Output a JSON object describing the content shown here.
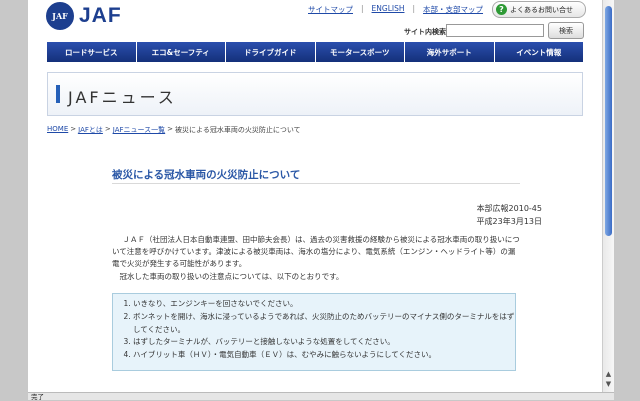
{
  "header": {
    "logo_mark": "JAF",
    "logo_text": "JAF",
    "links": [
      "サイトマップ",
      "ENGLISH",
      "本部・支部マップ"
    ],
    "faq_label": "よくあるお問い合せ",
    "search_label": "サイト内検索",
    "search_value": "",
    "search_button": "検索"
  },
  "nav": [
    "ロードサービス",
    "エコ&セーフティ",
    "ドライブガイド",
    "モータースポーツ",
    "海外サポート",
    "イベント情報"
  ],
  "section_title": "JAFニュース",
  "breadcrumb": {
    "home": "HOME",
    "about": "JAFとは",
    "news_list": "JAFニュース一覧",
    "current": "被災による冠水車両の火災防止について"
  },
  "article": {
    "title": "被災による冠水車両の火災防止について",
    "doc_number": "本部広報2010-45",
    "date": "平成23年3月13日",
    "para1": "ＪＡＦ（社団法人日本自動車連盟、田中節夫会長）は、過去の災害救援の経験から被災による冠水車両の取り扱いについて注意を呼びかけています。津波による被災車両は、海水の塩分により、電気系統（エンジン・ヘッドライト等）の漏電で火災が発生する可能性があります。",
    "para2": "冠水した車両の取り扱いの注意点については、以下のとおりです。",
    "notices": [
      "いきなり、エンジンキーを回さないでください。",
      "ボンネットを開け、海水に浸っているようであれば、火災防止のためバッテリーのマイナス側のターミナルをはずしてください。",
      "はずしたターミナルが、バッテリーと接触しないような処置をしてください。",
      "ハイブリット車（ＨＶ）・電気自動車（ＥＶ）は、むやみに触らないようにしてください。"
    ]
  },
  "status_text": "完了",
  "colors": {
    "brand": "#1d3f8f",
    "nav": "#1f3f94",
    "link": "#1f4aa8",
    "title": "#2a57a6",
    "notice_bg": "#e7f3fa"
  }
}
